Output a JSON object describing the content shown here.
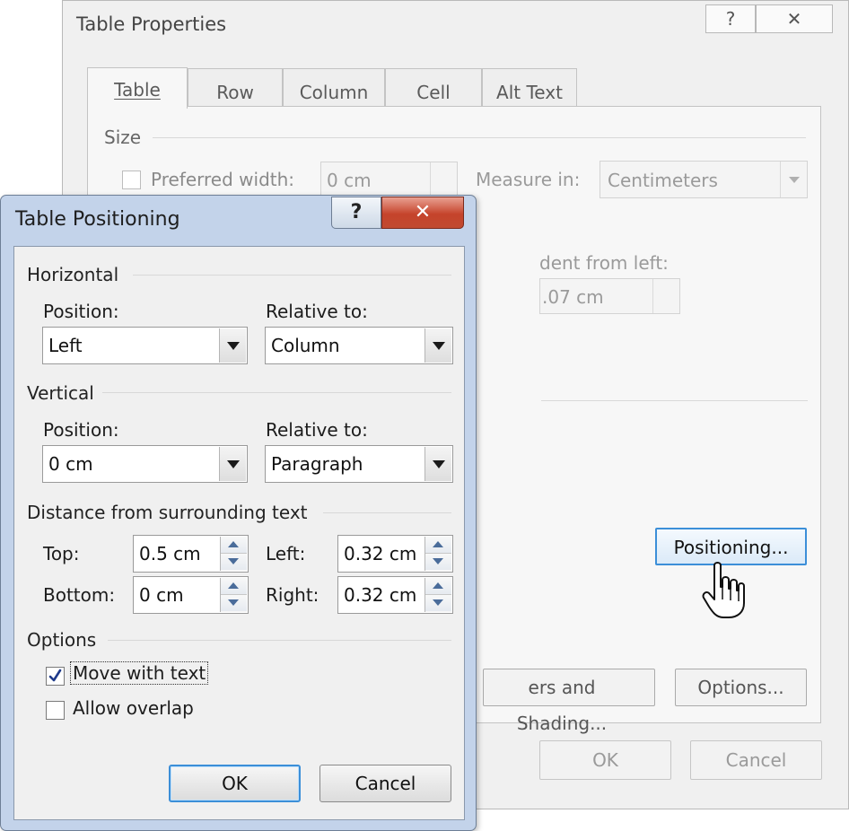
{
  "table_properties": {
    "title": "Table Properties",
    "help_label": "?",
    "close_label": "✕",
    "tabs": [
      {
        "label": "Table"
      },
      {
        "label": "Row"
      },
      {
        "label": "Column"
      },
      {
        "label": "Cell"
      },
      {
        "label": "Alt Text"
      }
    ],
    "size": {
      "heading": "Size",
      "preferred_width_label": "Preferred width:",
      "preferred_width_value": "0 cm",
      "measure_in_label": "Measure in:",
      "measure_in_value": "Centimeters"
    },
    "indent": {
      "label_partial": "dent from left:",
      "value_partial": ".07 cm"
    },
    "positioning_button": "Positioning...",
    "borders_button_partial": "ers and Shading...",
    "options_button": "Options...",
    "ok_button": "OK",
    "cancel_button": "Cancel"
  },
  "table_positioning": {
    "title": "Table Positioning",
    "help_label": "?",
    "close_label": "✕",
    "horizontal": {
      "heading": "Horizontal",
      "position_label": "Position:",
      "position_value": "Left",
      "relative_label": "Relative to:",
      "relative_value": "Column"
    },
    "vertical": {
      "heading": "Vertical",
      "position_label": "Position:",
      "position_value": "0 cm",
      "relative_label": "Relative to:",
      "relative_value": "Paragraph"
    },
    "distance": {
      "heading": "Distance from surrounding text",
      "top_label": "Top:",
      "top_value": "0.5 cm",
      "bottom_label": "Bottom:",
      "bottom_value": "0 cm",
      "left_label": "Left:",
      "left_value": "0.32 cm",
      "right_label": "Right:",
      "right_value": "0.32 cm"
    },
    "options": {
      "heading": "Options",
      "move_with_text_label": "Move with text",
      "move_with_text_checked": true,
      "allow_overlap_label": "Allow overlap",
      "allow_overlap_checked": false
    },
    "ok_button": "OK",
    "cancel_button": "Cancel"
  },
  "colors": {
    "dialog_frame": "#c3d3ea",
    "close_red": "#c5432b",
    "focus_blue": "#3c8fd8"
  }
}
